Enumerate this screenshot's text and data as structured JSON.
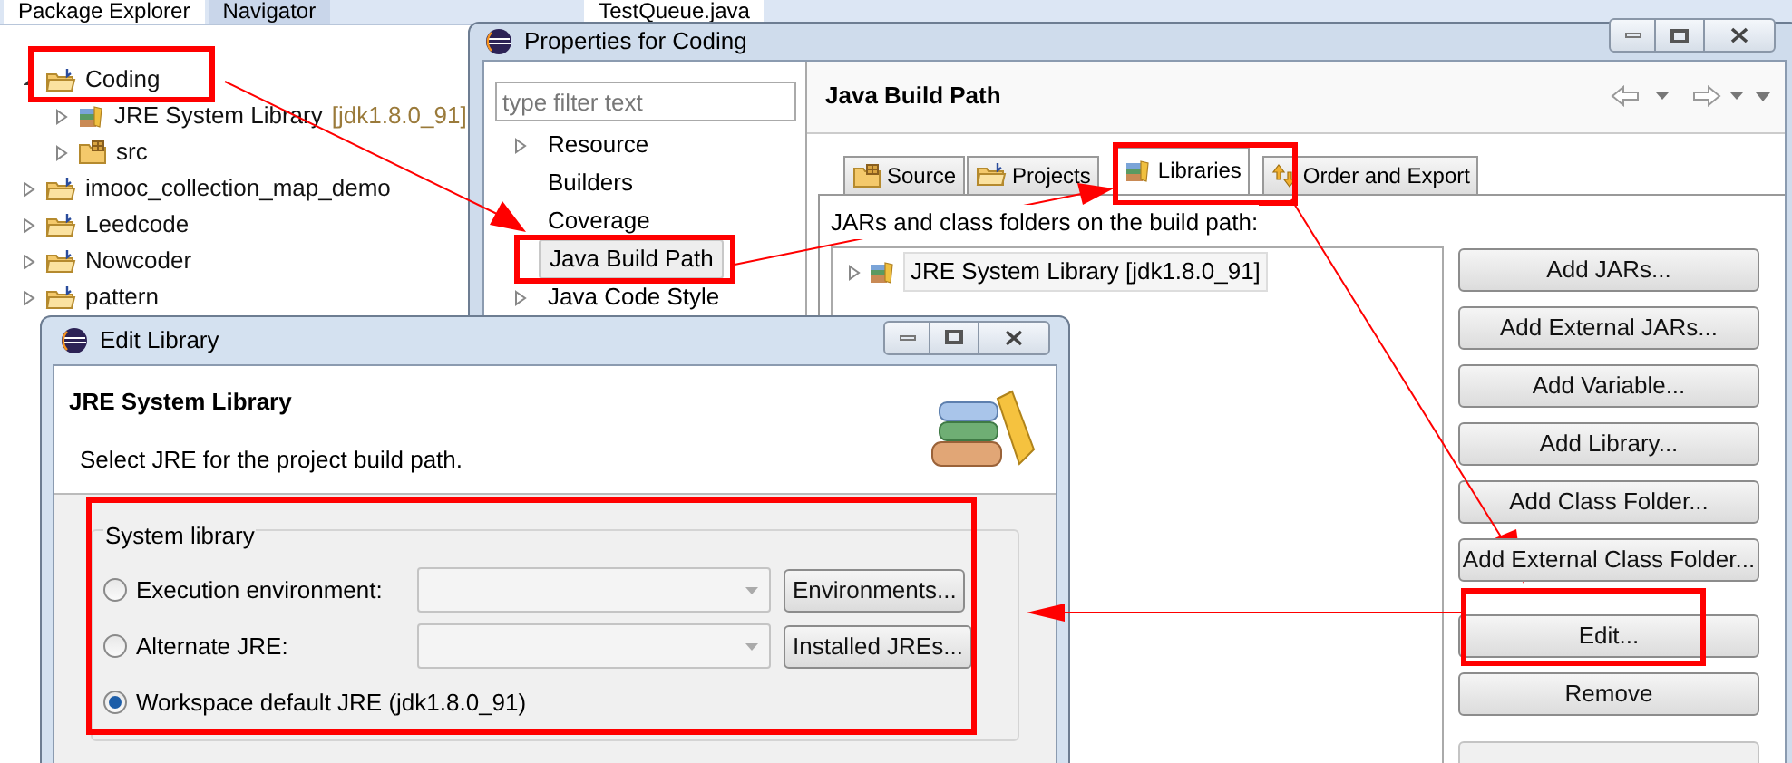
{
  "workbench_tabs": [
    {
      "label": "Package Explorer",
      "selected": true
    },
    {
      "label": "Navigator",
      "selected": false
    }
  ],
  "editor_tab": {
    "label": "TestQueue.java"
  },
  "package_tree": [
    {
      "label": "Coding",
      "expanded": true,
      "children": [
        {
          "label": "JRE System Library",
          "suffix": "[jdk1.8.0_91]",
          "kind": "library",
          "expanded": false
        },
        {
          "label": "src",
          "kind": "package",
          "expanded": false
        }
      ]
    },
    {
      "label": "imooc_collection_map_demo",
      "expanded": false
    },
    {
      "label": "Leedcode",
      "expanded": false
    },
    {
      "label": "Nowcoder",
      "expanded": false
    },
    {
      "label": "pattern",
      "expanded": false
    }
  ],
  "properties_window": {
    "title": "Properties for Coding",
    "filter": {
      "placeholder": "type filter text"
    },
    "nav": [
      {
        "label": "Resource",
        "expandable": true,
        "selected": false
      },
      {
        "label": "Builders",
        "expandable": false,
        "selected": false
      },
      {
        "label": "Coverage",
        "expandable": false,
        "selected": false
      },
      {
        "label": "Java Build Path",
        "expandable": false,
        "selected": true
      },
      {
        "label": "Java Code Style",
        "expandable": true,
        "selected": false
      }
    ],
    "page_title": "Java Build Path",
    "tabs": [
      {
        "label": "Source",
        "selected": false
      },
      {
        "label": "Projects",
        "selected": false
      },
      {
        "label": "Libraries",
        "selected": true
      },
      {
        "label": "Order and Export",
        "selected": false
      }
    ],
    "list_caption": "JARs and class folders on the build path:",
    "entries": [
      {
        "label": "JRE System Library [jdk1.8.0_91]"
      }
    ],
    "buttons": [
      {
        "label": "Add JARs..."
      },
      {
        "label": "Add External JARs..."
      },
      {
        "label": "Add Variable..."
      },
      {
        "label": "Add Library..."
      },
      {
        "label": "Add Class Folder..."
      },
      {
        "label": "Add External Class Folder..."
      },
      {
        "label": "Edit..."
      },
      {
        "label": "Remove"
      }
    ]
  },
  "edit_library": {
    "title": "Edit Library",
    "heading": "JRE System Library",
    "description": "Select JRE for the project build path.",
    "group": "System library",
    "options": [
      {
        "label": "Execution environment:",
        "selected": false,
        "kind": "combo",
        "button": "Environments..."
      },
      {
        "label": "Alternate JRE:",
        "selected": false,
        "kind": "combo",
        "button": "Installed JREs..."
      },
      {
        "label": "Workspace default JRE (jdk1.8.0_91)",
        "selected": true,
        "kind": "plain"
      }
    ]
  }
}
